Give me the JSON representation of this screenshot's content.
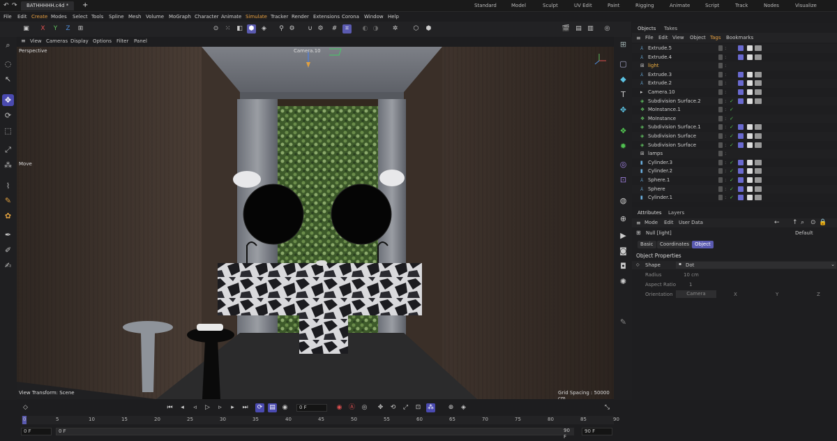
{
  "window": {
    "file_tab": "BATHHHHH.c4d *",
    "add_tab": "+"
  },
  "layouts": [
    "Standard",
    "Model",
    "Sculpt",
    "UV Edit",
    "Paint",
    "Rigging",
    "Animate",
    "Script",
    "Track",
    "Nodes",
    "Visualize"
  ],
  "menu": [
    "File",
    "Edit",
    "Create",
    "Modes",
    "Select",
    "Tools",
    "Spline",
    "Mesh",
    "Volume",
    "MoGraph",
    "Character",
    "Animate",
    "Simulate",
    "Tracker",
    "Render",
    "Extensions",
    "Corona",
    "Window",
    "Help"
  ],
  "toolbar": {
    "axes": [
      "X",
      "Y",
      "Z"
    ]
  },
  "viewport": {
    "menu": [
      "View",
      "Cameras",
      "Display",
      "Options",
      "Filter",
      "Panel"
    ],
    "label": "Perspective",
    "camera_label": "Camera.10",
    "move_label": "Move",
    "view_transform": "View Transform: Scene",
    "grid_spacing": "Grid Spacing : 50000 cm",
    "colors": {
      "wall": "#3a302b",
      "ceiling": "#6f7278",
      "marble": "#2a2a2e",
      "floor": "#2b2b2c"
    }
  },
  "objects_panel": {
    "tabs": [
      "Objects",
      "Takes"
    ],
    "menu": [
      "File",
      "Edit",
      "View",
      "Object",
      "Tags",
      "Bookmarks"
    ],
    "rows": [
      {
        "name": "Extrude.5",
        "icon": "extrude-icon",
        "selected": false
      },
      {
        "name": "Extrude.4",
        "icon": "extrude-icon",
        "selected": false
      },
      {
        "name": "light",
        "icon": "null-icon",
        "selected": true
      },
      {
        "name": "Extrude.3",
        "icon": "extrude-icon",
        "selected": false
      },
      {
        "name": "Extrude.2",
        "icon": "extrude-icon",
        "selected": false
      },
      {
        "name": "Camera.10",
        "icon": "camera-icon",
        "selected": false
      },
      {
        "name": "Subdivision Surface.2",
        "icon": "subdivision-icon",
        "selected": false
      },
      {
        "name": "MoInstance.1",
        "icon": "moinstance-icon",
        "selected": false
      },
      {
        "name": "MoInstance",
        "icon": "moinstance-icon",
        "selected": false
      },
      {
        "name": "Subdivision Surface.1",
        "icon": "subdivision-icon",
        "selected": false
      },
      {
        "name": "Subdivision Surface",
        "icon": "subdivision-icon",
        "selected": false
      },
      {
        "name": "Subdivision Surface",
        "icon": "subdivision-icon",
        "selected": false
      },
      {
        "name": "lamps",
        "icon": "null-icon",
        "selected": false
      },
      {
        "name": "Cylinder.3",
        "icon": "cylinder-icon",
        "selected": false
      },
      {
        "name": "Cylinder.2",
        "icon": "cylinder-icon",
        "selected": false
      },
      {
        "name": "Sphere.1",
        "icon": "sphere-icon",
        "selected": false
      },
      {
        "name": "Sphere",
        "icon": "sphere-icon",
        "selected": false
      },
      {
        "name": "Cylinder.1",
        "icon": "cylinder-icon",
        "selected": false
      }
    ]
  },
  "attributes": {
    "tabs": [
      "Attributes",
      "Layers"
    ],
    "menu": [
      "Mode",
      "Edit",
      "User Data"
    ],
    "object_name": "Null [light]",
    "preset": "Default",
    "subtabs": [
      "Basic",
      "Coordinates",
      "Object"
    ],
    "active_subtab": "Object",
    "section": "Object Properties",
    "shape_label": "Shape",
    "shape_value": "Dot",
    "radius_label": "Radius",
    "radius_value": "10 cm",
    "aspect_label": "Aspect Ratio",
    "aspect_value": "1",
    "orientation_label": "Orientation",
    "orientation_value": "Camera",
    "orientation_axes": [
      "X",
      "Y",
      "Z"
    ]
  },
  "timeline": {
    "current_frame": "0 F",
    "ticks": [
      "0",
      "5",
      "10",
      "15",
      "20",
      "25",
      "30",
      "35",
      "40",
      "45",
      "50",
      "55",
      "60",
      "65",
      "70",
      "75",
      "80",
      "85",
      "90"
    ],
    "start_field": "0 F",
    "start_field2": "0 F",
    "end_field": "90 F",
    "end_field2": "90 F"
  }
}
